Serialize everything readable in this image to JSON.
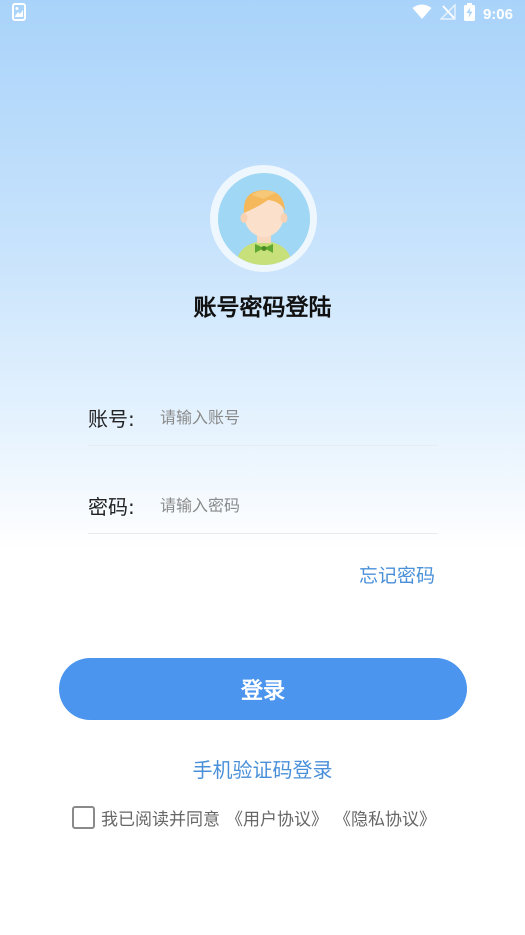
{
  "status_bar": {
    "time": "9:06",
    "icons": [
      "app-notification-icon",
      "wifi-icon",
      "no-signal-icon",
      "battery-charging-icon"
    ]
  },
  "avatar": {
    "icon": "boy-avatar-icon"
  },
  "title": "账号密码登陆",
  "form": {
    "account_label": "账号:",
    "account_placeholder": "请输入账号",
    "account_value": "",
    "password_label": "密码:",
    "password_placeholder": "请输入密码",
    "password_value": ""
  },
  "forgot_password": "忘记密码",
  "login_button": "登录",
  "sms_login": "手机验证码登录",
  "agreement": {
    "checked": false,
    "prefix": "我已阅读并同意",
    "user_agreement": "《用户协议》",
    "privacy_agreement": "《隐私协议》"
  },
  "colors": {
    "primary": "#4b95ee",
    "link": "#4a90d9",
    "gradient_top": "#a9d3fa"
  }
}
